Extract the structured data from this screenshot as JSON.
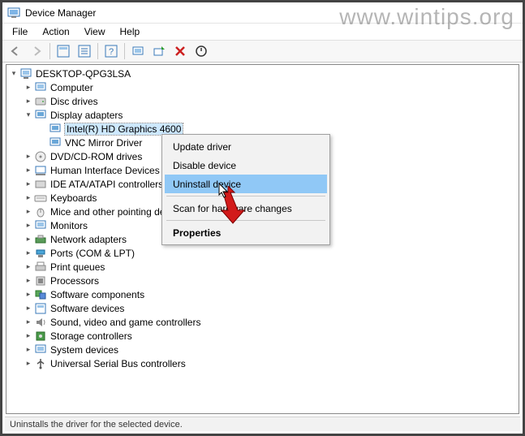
{
  "watermark": "www.wintips.org",
  "window": {
    "title": "Device Manager"
  },
  "menu": {
    "file": "File",
    "action": "Action",
    "view": "View",
    "help": "Help"
  },
  "tree": {
    "root": "DESKTOP-QPG3LSA",
    "computer": "Computer",
    "disk_drives": "Disc drives",
    "display_adapters": "Display adapters",
    "intel_gpu": "Intel(R) HD Graphics 4600",
    "vnc_mirror": "VNC Mirror Driver",
    "dvd": "DVD/CD-ROM drives",
    "hid": "Human Interface Devices",
    "ide": "IDE ATA/ATAPI controllers",
    "keyboards": "Keyboards",
    "mice": "Mice and other pointing devices",
    "monitors": "Monitors",
    "network": "Network adapters",
    "ports": "Ports (COM & LPT)",
    "print_queues": "Print queues",
    "processors": "Processors",
    "sw_components": "Software components",
    "sw_devices": "Software devices",
    "sound": "Sound, video and game controllers",
    "storage": "Storage controllers",
    "system": "System devices",
    "usb": "Universal Serial Bus controllers"
  },
  "context_menu": {
    "update": "Update driver",
    "disable": "Disable device",
    "uninstall": "Uninstall device",
    "scan": "Scan for hardware changes",
    "properties": "Properties"
  },
  "status": "Uninstalls the driver for the selected device."
}
